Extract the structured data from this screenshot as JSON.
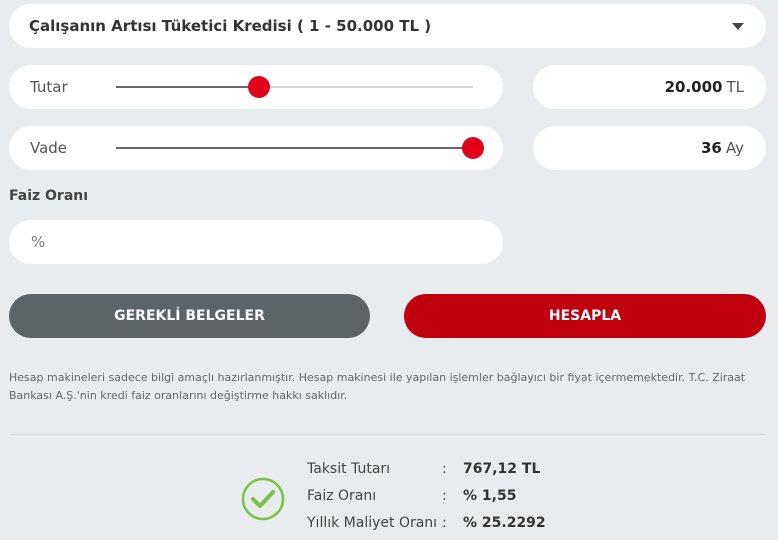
{
  "loan_type": {
    "selected": "Çalışanın Artısı Tüketici Kredisi ( 1 - 50.000 TL )",
    "icon": "chevron-down-icon"
  },
  "amount": {
    "label": "Tutar",
    "value": "20.000",
    "unit": "TL",
    "slider_fraction": 0.4
  },
  "term": {
    "label": "Vade",
    "value": "36",
    "unit": "Ay",
    "slider_fraction": 1.0
  },
  "interest": {
    "label": "Faiz Oranı",
    "placeholder": "%"
  },
  "buttons": {
    "documents": "GEREKLİ BELGELER",
    "calculate": "HESAPLA"
  },
  "disclaimer": "Hesap makineleri sadece bilgi amaçlı hazırlanmıştır. Hesap makinesi ile yapılan işlemler bağlayıcı bir fiyat içermemektedir. T.C. Ziraat Bankası A.Ş.'nin kredi faiz oranlarını değiştirme hakkı saklıdır.",
  "results": [
    {
      "label": "Taksit Tutarı",
      "value": "767,12 TL"
    },
    {
      "label": "Faiz Oranı",
      "value": "% 1,55"
    },
    {
      "label": "Yıllık Maliyet Oranı",
      "value": "% 25.2292"
    }
  ],
  "colors": {
    "accent": "#c0000f",
    "thumb": "#e1001a",
    "success": "#7bc143"
  }
}
